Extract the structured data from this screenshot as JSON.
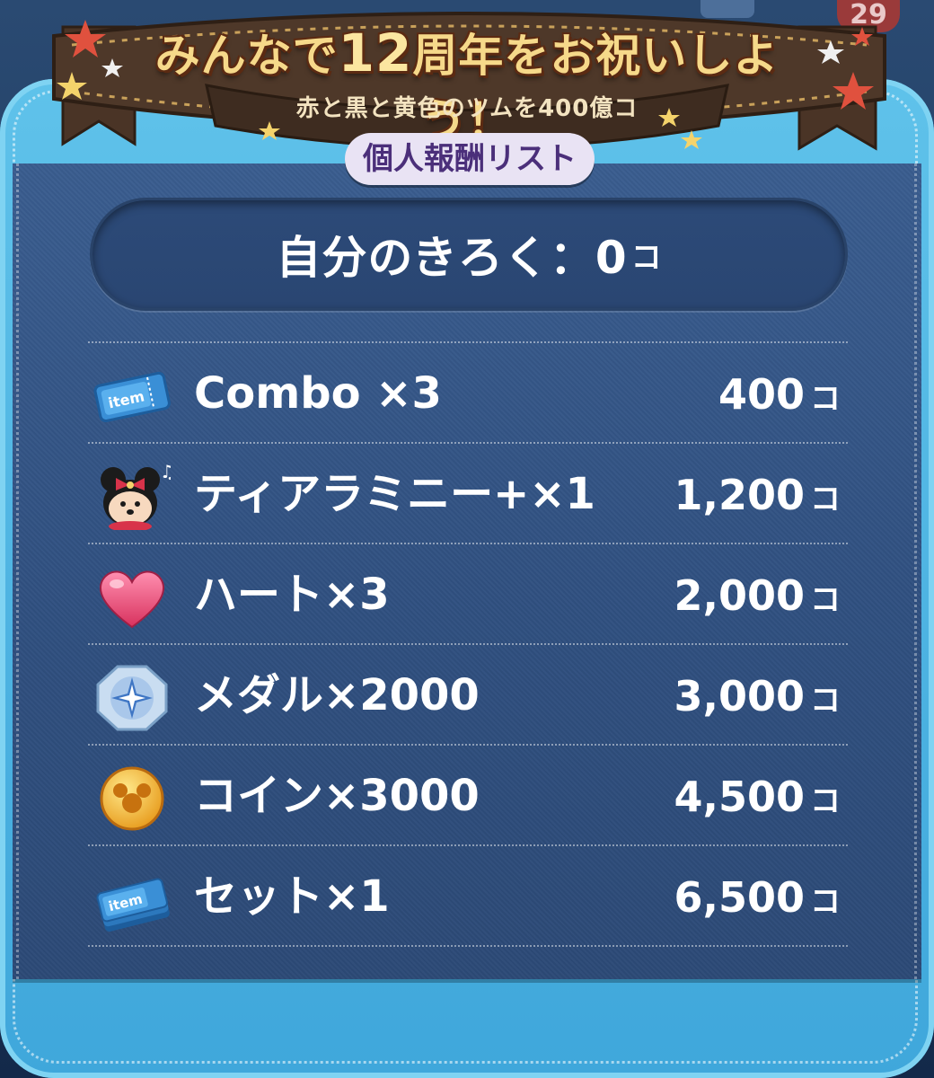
{
  "banner": {
    "title_pre": "みんなで",
    "title_num": "12",
    "title_post": "周年をお祝いしよう！",
    "subtitle": "赤と黒と黄色のツムを400億コ",
    "list_tag": "個人報酬リスト"
  },
  "background": {
    "badge_count": "29"
  },
  "record": {
    "label": "自分のきろく：0",
    "unit": "コ"
  },
  "rewards": [
    {
      "icon": "item-ticket-icon",
      "label": "Combo ×3",
      "value": "400",
      "unit": "コ"
    },
    {
      "icon": "minnie-tsum-icon",
      "label": "ティアラミニー+×1",
      "value": "1,200",
      "unit": "コ"
    },
    {
      "icon": "heart-icon",
      "label": "ハート×3",
      "value": "2,000",
      "unit": "コ"
    },
    {
      "icon": "medal-icon",
      "label": "メダル×2000",
      "value": "3,000",
      "unit": "コ"
    },
    {
      "icon": "coin-icon",
      "label": "コイン×3000",
      "value": "4,500",
      "unit": "コ"
    },
    {
      "icon": "item-ticket-set-icon",
      "label": "セット×1",
      "value": "6,500",
      "unit": "コ"
    }
  ],
  "colors": {
    "frame": "#4fb6e4",
    "panel": "#33558a",
    "banner_brown": "#4a3426",
    "title_gold": "#f6d98a",
    "tag_purple": "#4b2f7a"
  }
}
